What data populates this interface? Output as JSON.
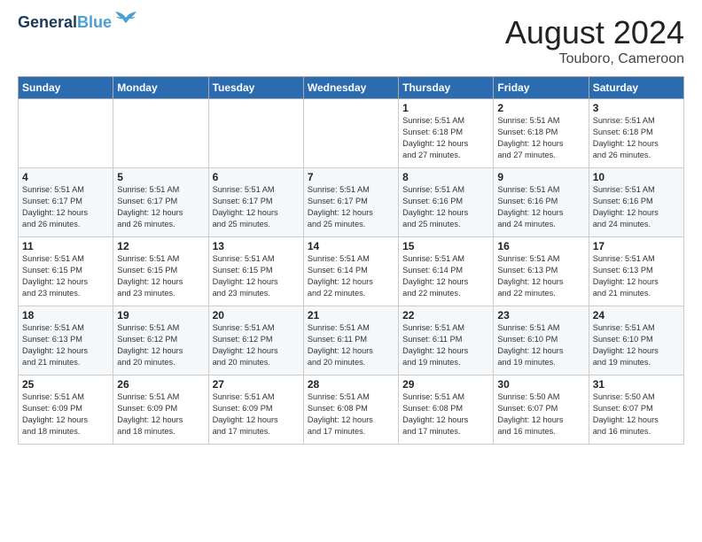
{
  "header": {
    "logo_line1": "General",
    "logo_line2": "Blue",
    "month": "August 2024",
    "location": "Touboro, Cameroon"
  },
  "weekdays": [
    "Sunday",
    "Monday",
    "Tuesday",
    "Wednesday",
    "Thursday",
    "Friday",
    "Saturday"
  ],
  "weeks": [
    [
      {
        "day": "",
        "info": ""
      },
      {
        "day": "",
        "info": ""
      },
      {
        "day": "",
        "info": ""
      },
      {
        "day": "",
        "info": ""
      },
      {
        "day": "1",
        "info": "Sunrise: 5:51 AM\nSunset: 6:18 PM\nDaylight: 12 hours\nand 27 minutes."
      },
      {
        "day": "2",
        "info": "Sunrise: 5:51 AM\nSunset: 6:18 PM\nDaylight: 12 hours\nand 27 minutes."
      },
      {
        "day": "3",
        "info": "Sunrise: 5:51 AM\nSunset: 6:18 PM\nDaylight: 12 hours\nand 26 minutes."
      }
    ],
    [
      {
        "day": "4",
        "info": "Sunrise: 5:51 AM\nSunset: 6:17 PM\nDaylight: 12 hours\nand 26 minutes."
      },
      {
        "day": "5",
        "info": "Sunrise: 5:51 AM\nSunset: 6:17 PM\nDaylight: 12 hours\nand 26 minutes."
      },
      {
        "day": "6",
        "info": "Sunrise: 5:51 AM\nSunset: 6:17 PM\nDaylight: 12 hours\nand 25 minutes."
      },
      {
        "day": "7",
        "info": "Sunrise: 5:51 AM\nSunset: 6:17 PM\nDaylight: 12 hours\nand 25 minutes."
      },
      {
        "day": "8",
        "info": "Sunrise: 5:51 AM\nSunset: 6:16 PM\nDaylight: 12 hours\nand 25 minutes."
      },
      {
        "day": "9",
        "info": "Sunrise: 5:51 AM\nSunset: 6:16 PM\nDaylight: 12 hours\nand 24 minutes."
      },
      {
        "day": "10",
        "info": "Sunrise: 5:51 AM\nSunset: 6:16 PM\nDaylight: 12 hours\nand 24 minutes."
      }
    ],
    [
      {
        "day": "11",
        "info": "Sunrise: 5:51 AM\nSunset: 6:15 PM\nDaylight: 12 hours\nand 23 minutes."
      },
      {
        "day": "12",
        "info": "Sunrise: 5:51 AM\nSunset: 6:15 PM\nDaylight: 12 hours\nand 23 minutes."
      },
      {
        "day": "13",
        "info": "Sunrise: 5:51 AM\nSunset: 6:15 PM\nDaylight: 12 hours\nand 23 minutes."
      },
      {
        "day": "14",
        "info": "Sunrise: 5:51 AM\nSunset: 6:14 PM\nDaylight: 12 hours\nand 22 minutes."
      },
      {
        "day": "15",
        "info": "Sunrise: 5:51 AM\nSunset: 6:14 PM\nDaylight: 12 hours\nand 22 minutes."
      },
      {
        "day": "16",
        "info": "Sunrise: 5:51 AM\nSunset: 6:13 PM\nDaylight: 12 hours\nand 22 minutes."
      },
      {
        "day": "17",
        "info": "Sunrise: 5:51 AM\nSunset: 6:13 PM\nDaylight: 12 hours\nand 21 minutes."
      }
    ],
    [
      {
        "day": "18",
        "info": "Sunrise: 5:51 AM\nSunset: 6:13 PM\nDaylight: 12 hours\nand 21 minutes."
      },
      {
        "day": "19",
        "info": "Sunrise: 5:51 AM\nSunset: 6:12 PM\nDaylight: 12 hours\nand 20 minutes."
      },
      {
        "day": "20",
        "info": "Sunrise: 5:51 AM\nSunset: 6:12 PM\nDaylight: 12 hours\nand 20 minutes."
      },
      {
        "day": "21",
        "info": "Sunrise: 5:51 AM\nSunset: 6:11 PM\nDaylight: 12 hours\nand 20 minutes."
      },
      {
        "day": "22",
        "info": "Sunrise: 5:51 AM\nSunset: 6:11 PM\nDaylight: 12 hours\nand 19 minutes."
      },
      {
        "day": "23",
        "info": "Sunrise: 5:51 AM\nSunset: 6:10 PM\nDaylight: 12 hours\nand 19 minutes."
      },
      {
        "day": "24",
        "info": "Sunrise: 5:51 AM\nSunset: 6:10 PM\nDaylight: 12 hours\nand 19 minutes."
      }
    ],
    [
      {
        "day": "25",
        "info": "Sunrise: 5:51 AM\nSunset: 6:09 PM\nDaylight: 12 hours\nand 18 minutes."
      },
      {
        "day": "26",
        "info": "Sunrise: 5:51 AM\nSunset: 6:09 PM\nDaylight: 12 hours\nand 18 minutes."
      },
      {
        "day": "27",
        "info": "Sunrise: 5:51 AM\nSunset: 6:09 PM\nDaylight: 12 hours\nand 17 minutes."
      },
      {
        "day": "28",
        "info": "Sunrise: 5:51 AM\nSunset: 6:08 PM\nDaylight: 12 hours\nand 17 minutes."
      },
      {
        "day": "29",
        "info": "Sunrise: 5:51 AM\nSunset: 6:08 PM\nDaylight: 12 hours\nand 17 minutes."
      },
      {
        "day": "30",
        "info": "Sunrise: 5:50 AM\nSunset: 6:07 PM\nDaylight: 12 hours\nand 16 minutes."
      },
      {
        "day": "31",
        "info": "Sunrise: 5:50 AM\nSunset: 6:07 PM\nDaylight: 12 hours\nand 16 minutes."
      }
    ]
  ]
}
